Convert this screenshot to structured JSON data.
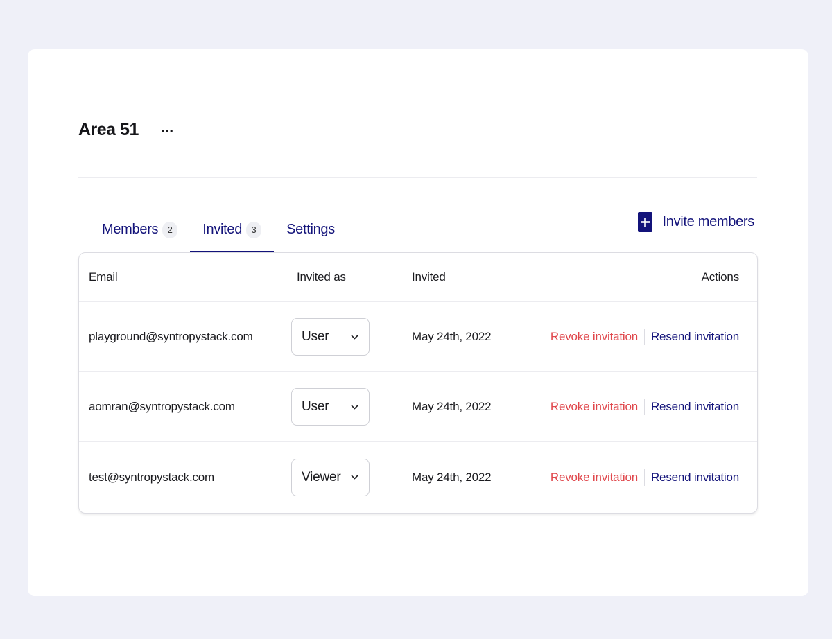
{
  "header": {
    "title": "Area 51",
    "more": "..."
  },
  "tabs": [
    {
      "label": "Members",
      "count": "2",
      "active": false
    },
    {
      "label": "Invited",
      "count": "3",
      "active": true
    },
    {
      "label": "Settings",
      "count": null,
      "active": false
    }
  ],
  "invite": {
    "label": "Invite members",
    "icon": "plus-icon"
  },
  "table": {
    "columns": [
      "Email",
      "Invited as",
      "Invited",
      "Actions"
    ],
    "rows": [
      {
        "email": "playground@syntropystack.com",
        "role": "User",
        "date": "May 24th, 2022",
        "revoke": "Revoke invitation",
        "resend": "Resend invitation"
      },
      {
        "email": "aomran@syntropystack.com",
        "role": "User",
        "date": "May 24th, 2022",
        "revoke": "Revoke invitation",
        "resend": "Resend invitation"
      },
      {
        "email": "test@syntropystack.com",
        "role": "Viewer",
        "date": "May 24th, 2022",
        "revoke": "Revoke invitation",
        "resend": "Resend invitation"
      }
    ]
  },
  "colors": {
    "primary": "#13137a",
    "danger": "#e0474c",
    "background": "#eff0f8"
  }
}
